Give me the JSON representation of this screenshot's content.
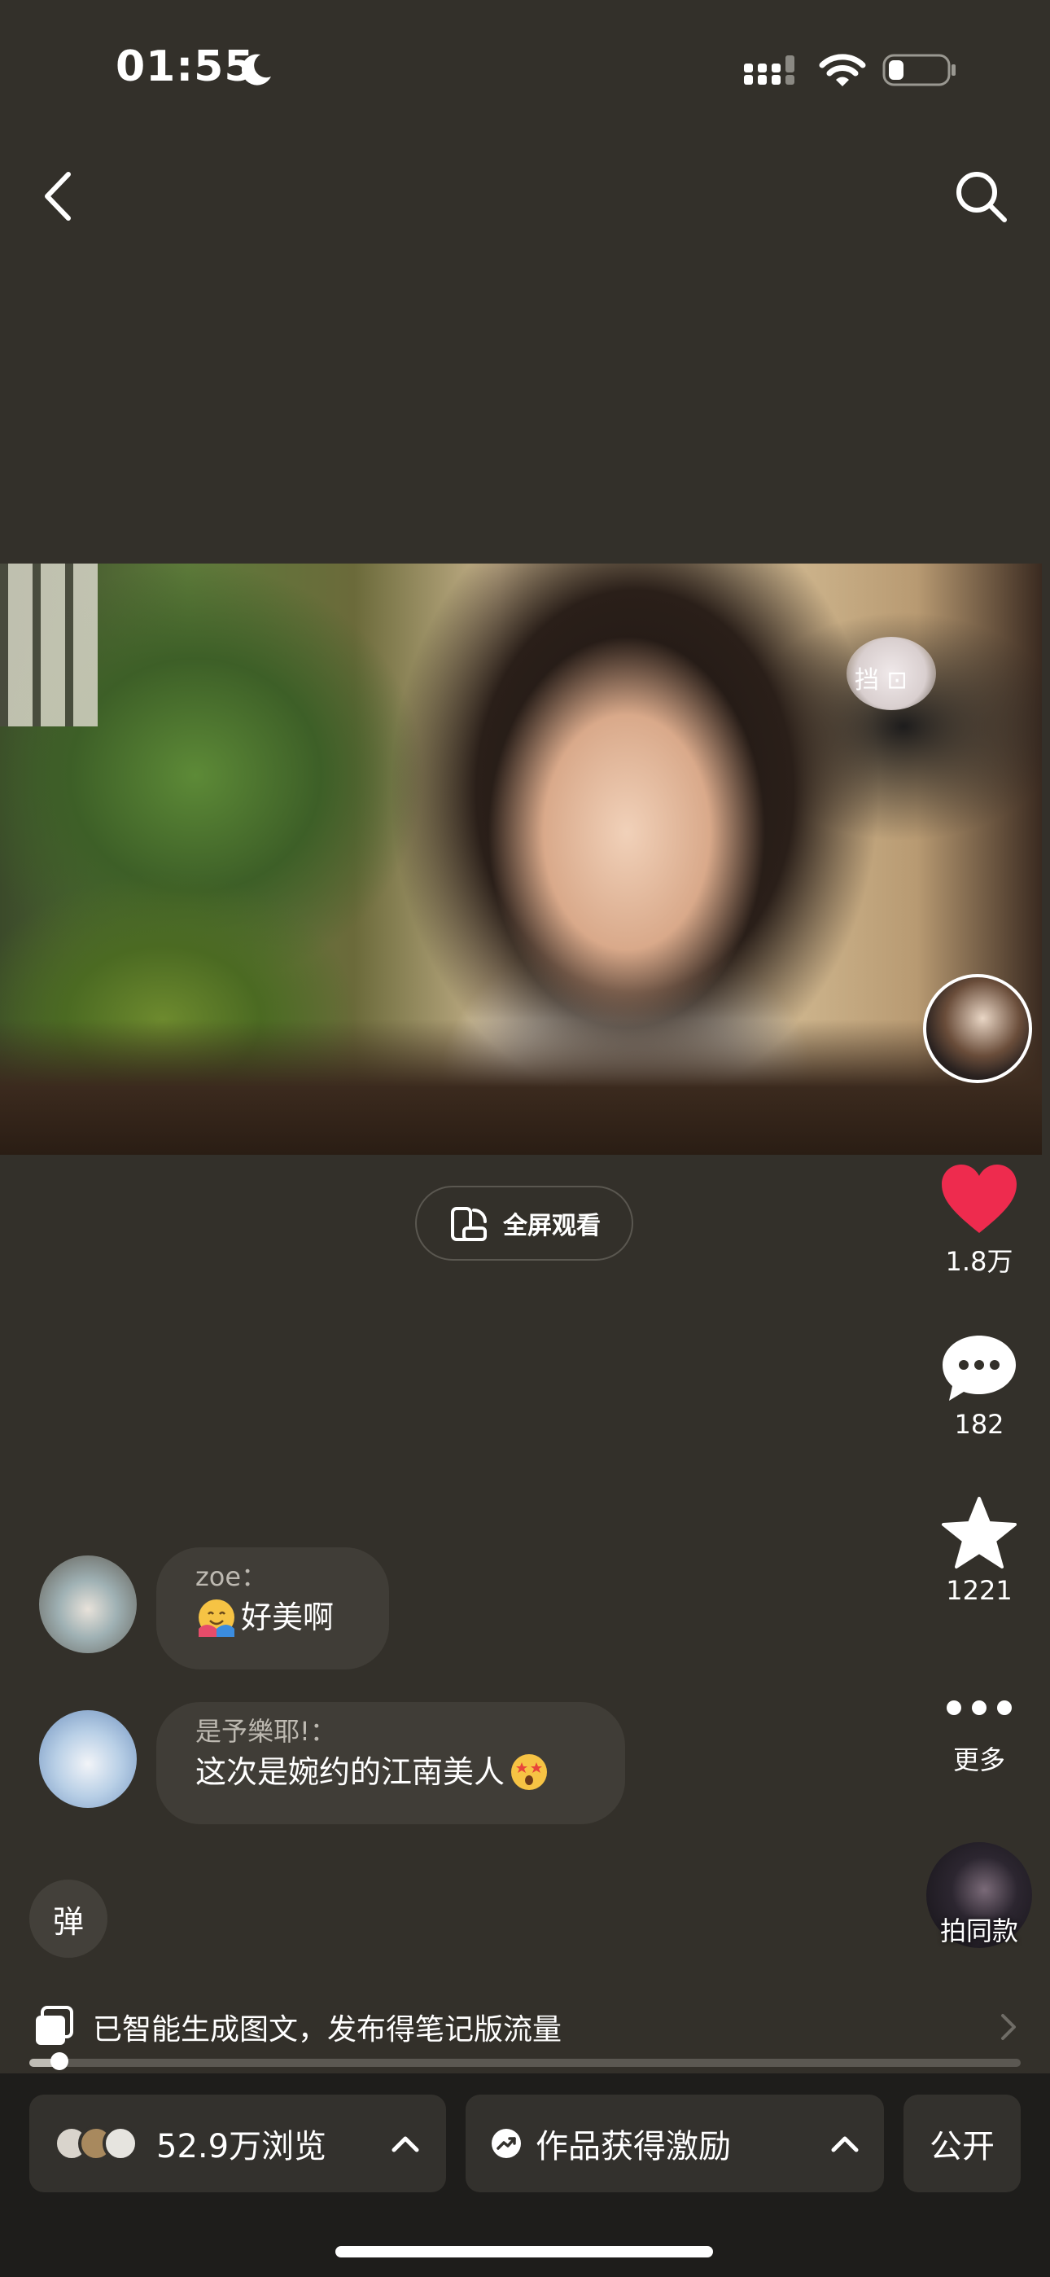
{
  "status_bar": {
    "time": "01:55"
  },
  "video": {
    "overlay_text": "挡 ⊡"
  },
  "fullscreen_button": {
    "label": "全屏观看"
  },
  "actions": [
    {
      "name": "like",
      "label": "1.8万",
      "color": "#ee2b4e"
    },
    {
      "name": "comment",
      "label": "182"
    },
    {
      "name": "favorite",
      "label": "1221"
    },
    {
      "name": "more",
      "label": "更多"
    },
    {
      "name": "same-style",
      "label": "拍同款"
    }
  ],
  "comments": [
    {
      "user": "zoe：",
      "text": "好美啊"
    },
    {
      "user": "是予樂耶!：",
      "text": "这次是婉约的江南美人"
    }
  ],
  "danmu_button": {
    "label": "弹"
  },
  "ai_notice": {
    "text": "已智能生成图文，发布得笔记版流量"
  },
  "playback": {
    "progress": 0.03
  },
  "bottom_bar": {
    "views": "52.9万浏览",
    "incentive": "作品获得激励",
    "visibility": "公开"
  }
}
